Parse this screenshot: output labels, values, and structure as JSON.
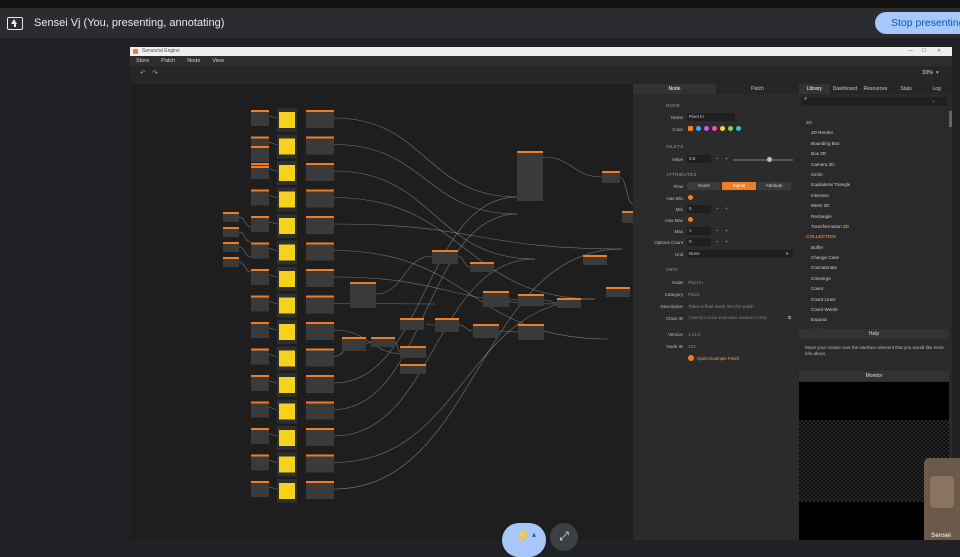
{
  "meet": {
    "title": "Sensei Vj (You, presenting, annotating)",
    "stop_button": "Stop presenting",
    "self_name": "Sensei"
  },
  "app": {
    "title": "Sensorial Engine",
    "menu": [
      "Store",
      "Patch",
      "Node",
      "View"
    ],
    "zoom": "33%",
    "node_panel": {
      "tabs": [
        "Node",
        "Patch"
      ],
      "sections": {
        "node": "NODE",
        "inlets": "INLETS",
        "attributes": "ATTRIBUTES",
        "info": "INFO"
      },
      "name_label": "Name",
      "name_value": "Pixel In",
      "color_label": "Color",
      "swatches": [
        "#f07d21",
        "#3fa7ff",
        "#c05cff",
        "#ff4da6",
        "#ffd23f",
        "#7cd46a",
        "#40c4c4"
      ],
      "value_label": "Value",
      "value_value": "0.6",
      "flow_label": "Flow",
      "flow_options": [
        "Event",
        "Signal",
        "Attribute"
      ],
      "has_min_label": "Has Min",
      "min_label": "Min",
      "min_value": "0",
      "has_max_label": "Has Max",
      "max_label": "Max",
      "max_value": "1",
      "options_count_label": "Options Count",
      "options_count_value": "0",
      "unit_label": "Unit",
      "unit_value": "None",
      "info_node_label": "Node",
      "info_node_value": "Pixel In",
      "category_label": "Category",
      "category_value": "Patch",
      "description_label": "Description",
      "description_value": "Takes a float event into the patch",
      "class_id_label": "Class ID",
      "class_id_value": "7736F5C3-0CDE-4F69-B661-32A5D3C7CF3D",
      "version_label": "Version",
      "version_value": "1.12.0",
      "node_id_label": "Node ID",
      "node_id_value": "133",
      "example_link": "Open Example Patch"
    },
    "library": {
      "tabs": [
        "Library",
        "Dashboard",
        "Resources",
        "Stats",
        "Log"
      ],
      "search_icon": "search-icon",
      "sections": [
        {
          "category": "2D",
          "items": [
            "2D Render",
            "Bounding Box",
            "Box 2D",
            "Camera 2D",
            "Circle",
            "Equilateral Triangle",
            "Intersect",
            "Mesh 2D",
            "Rectangle",
            "Transformation 2D"
          ]
        },
        {
          "category": "COLLECTION",
          "items": [
            "Buffer",
            "Change Case",
            "Concatenate",
            "Converge",
            "Count",
            "Count Lines",
            "Count Words",
            "Expand",
            "Find"
          ]
        }
      ],
      "help_title": "Help",
      "help_text": "Move your mouse over the interface element that you would like more info about.",
      "monitor_title": "Monitor"
    }
  },
  "colors": {
    "accent": "#f07d21",
    "meet_blue": "#a8c7fa",
    "node_yellow": "#f5d21c"
  }
}
